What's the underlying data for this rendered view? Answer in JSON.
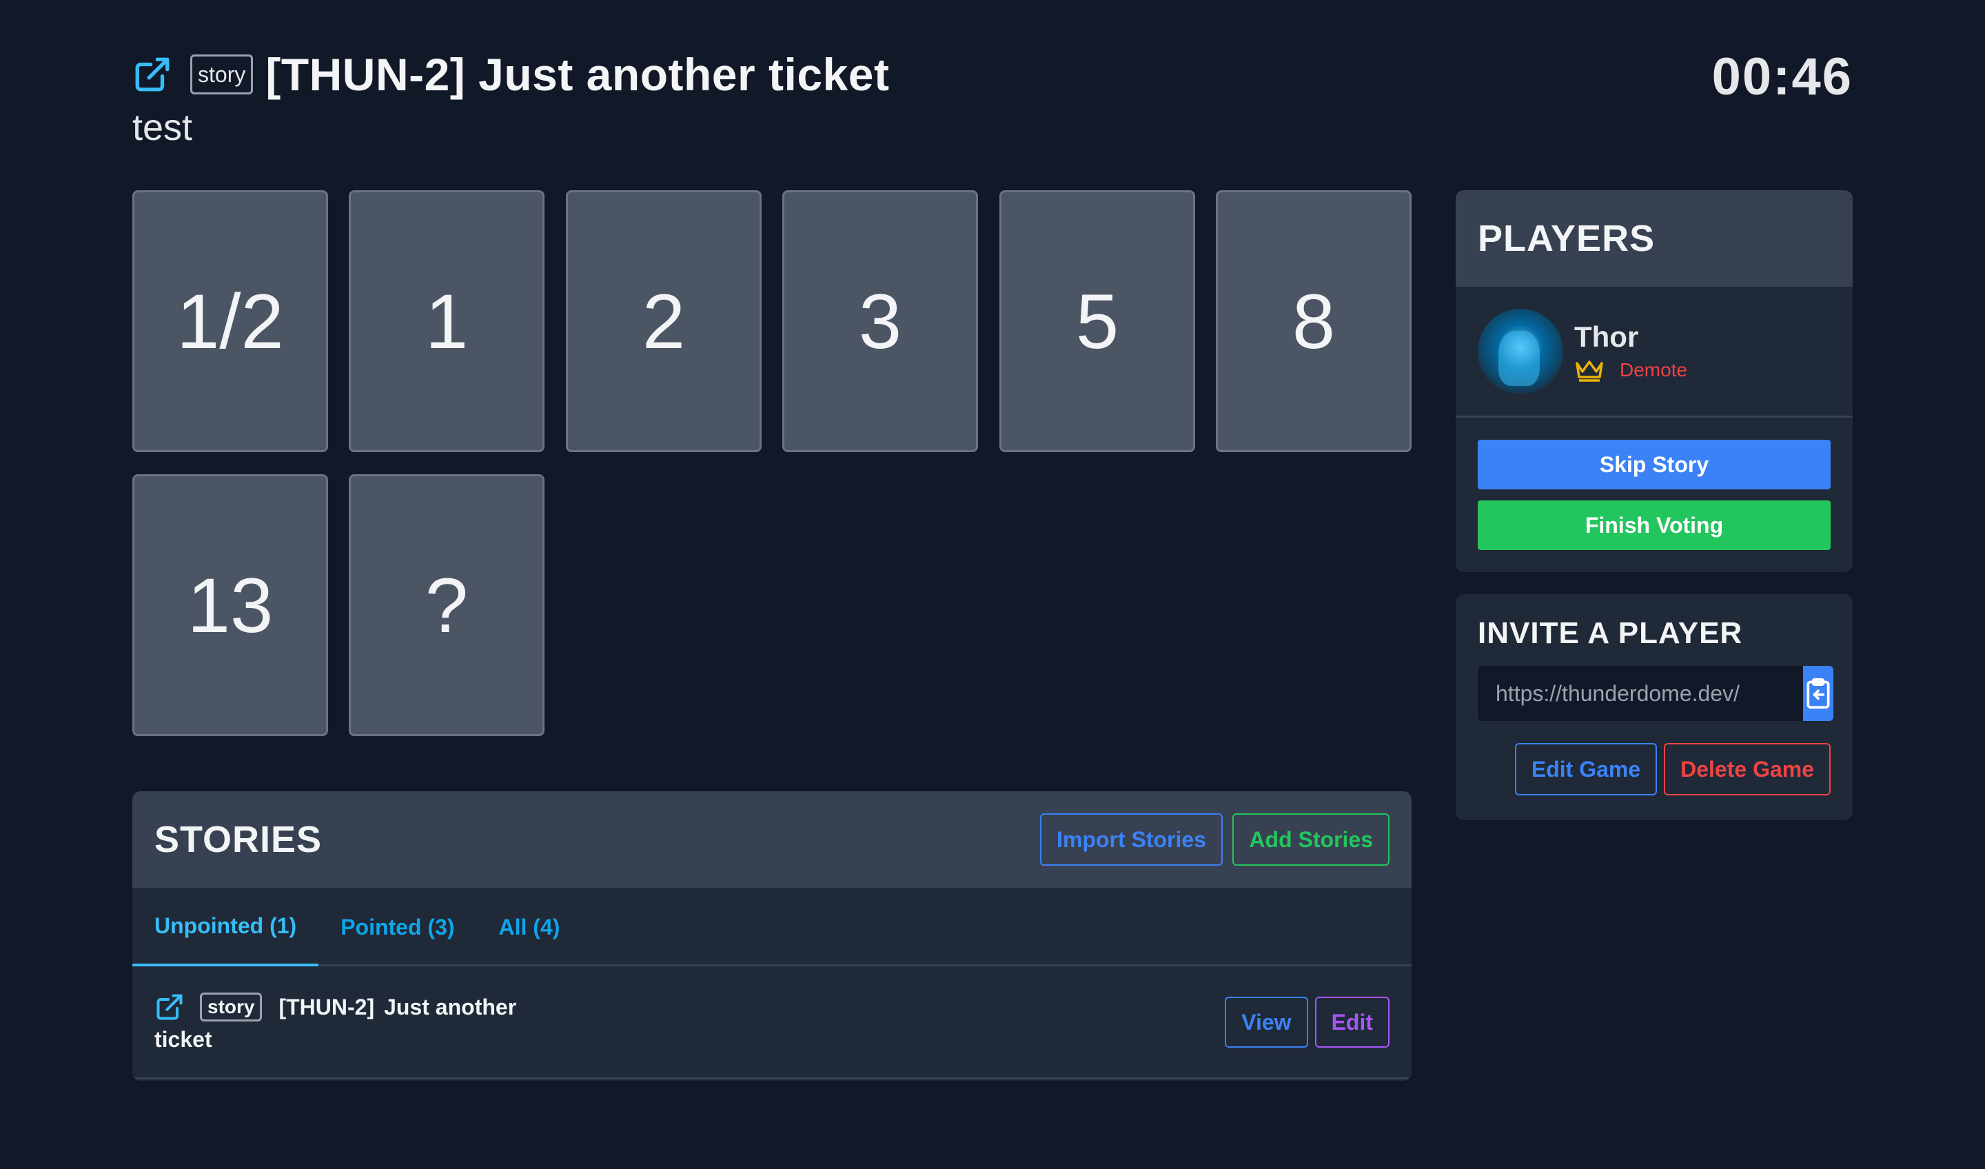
{
  "story": {
    "type": "story",
    "title": "[THUN-2] Just another ticket",
    "description": "test"
  },
  "timer": "00:46",
  "cards": [
    "1/2",
    "1",
    "2",
    "3",
    "5",
    "8",
    "13",
    "?"
  ],
  "stories_panel": {
    "title": "STORIES",
    "import_label": "Import Stories",
    "add_label": "Add Stories",
    "tabs": [
      {
        "label": "Unpointed (1)"
      },
      {
        "label": "Pointed (3)"
      },
      {
        "label": "All (4)"
      }
    ],
    "items": [
      {
        "type": "story",
        "key": "[THUN-2]",
        "name_line1": "Just another",
        "name_line2": "ticket",
        "view_label": "View",
        "edit_label": "Edit"
      }
    ]
  },
  "players_panel": {
    "title": "PLAYERS",
    "players": [
      {
        "name": "Thor",
        "action": "Demote",
        "icon": "crown-icon"
      }
    ],
    "skip_label": "Skip Story",
    "finish_label": "Finish Voting"
  },
  "invite_panel": {
    "title": "INVITE A PLAYER",
    "link": "https://thunderdome.dev/",
    "edit_label": "Edit Game",
    "delete_label": "Delete Game"
  },
  "colors": {
    "background": "#111827",
    "panel": "#1f2937",
    "panel_header": "#374151",
    "card": "#4b5563",
    "blue": "#3b82f6",
    "green": "#22c55e",
    "red": "#ef4444",
    "purple": "#a855f7",
    "link": "#38bdf8"
  }
}
